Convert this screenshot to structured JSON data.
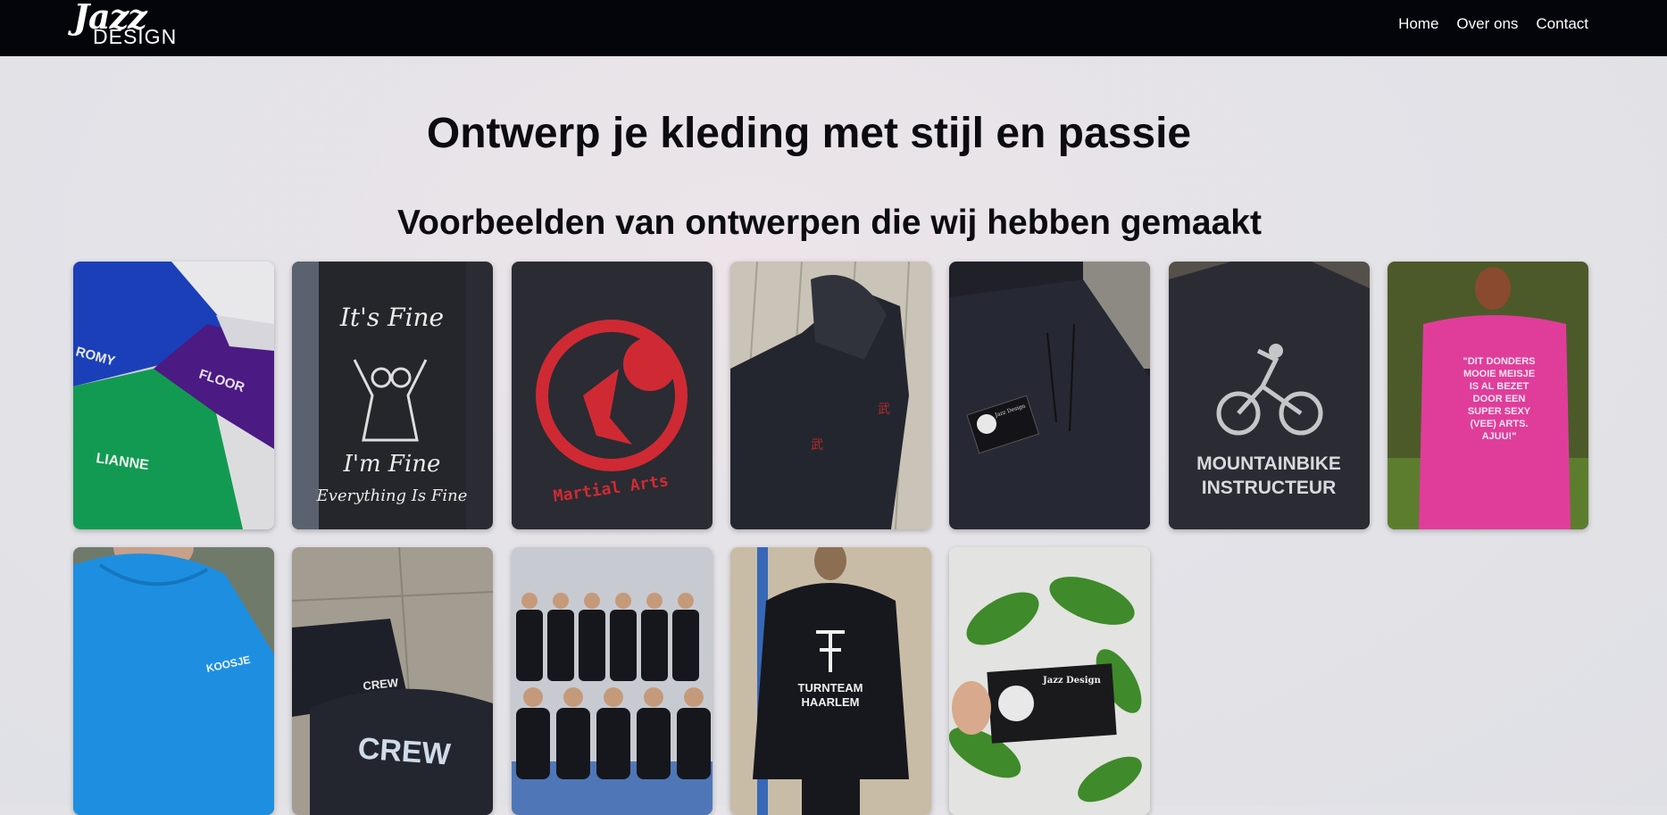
{
  "brand": {
    "logo_top": "Jazz",
    "logo_bottom": "DESIGN"
  },
  "nav": {
    "items": [
      {
        "label": "Home"
      },
      {
        "label": "Over ons"
      },
      {
        "label": "Contact"
      }
    ]
  },
  "hero": {
    "title": "Ontwerp je kleding met stijl en passie"
  },
  "gallery": {
    "heading": "Voorbeelden van ontwerpen die wij hebben gemaakt",
    "tiles": [
      {
        "texts": [
          "ROMY",
          "FLOOR",
          "LIANNE"
        ]
      },
      {
        "texts": [
          "It's Fine",
          "I'm Fine",
          "Everything Is Fine"
        ]
      },
      {
        "texts": [
          "Martial Arts"
        ]
      },
      {
        "texts": []
      },
      {
        "texts": [
          "Jazz Design"
        ]
      },
      {
        "texts": [
          "MOUNTAINBIKE",
          "INSTRUCTEUR"
        ]
      },
      {
        "texts": [
          "\"DIT DONDERS",
          "MOOIE MEISJE",
          "IS AL BEZET",
          "DOOR EEN",
          "SUPER SEXY",
          "(VEE) ARTS.",
          "AJUU!\""
        ]
      },
      {
        "texts": [
          "KOOSJE"
        ]
      },
      {
        "texts": [
          "CREW",
          "CREW"
        ]
      },
      {
        "texts": []
      },
      {
        "texts": [
          "TURNTEAM",
          "HAARLEM"
        ]
      },
      {
        "texts": [
          "Jazz Design"
        ]
      }
    ]
  },
  "colors": {
    "nav_bg": "#04040b",
    "page_bg": "#e2e2e7"
  }
}
